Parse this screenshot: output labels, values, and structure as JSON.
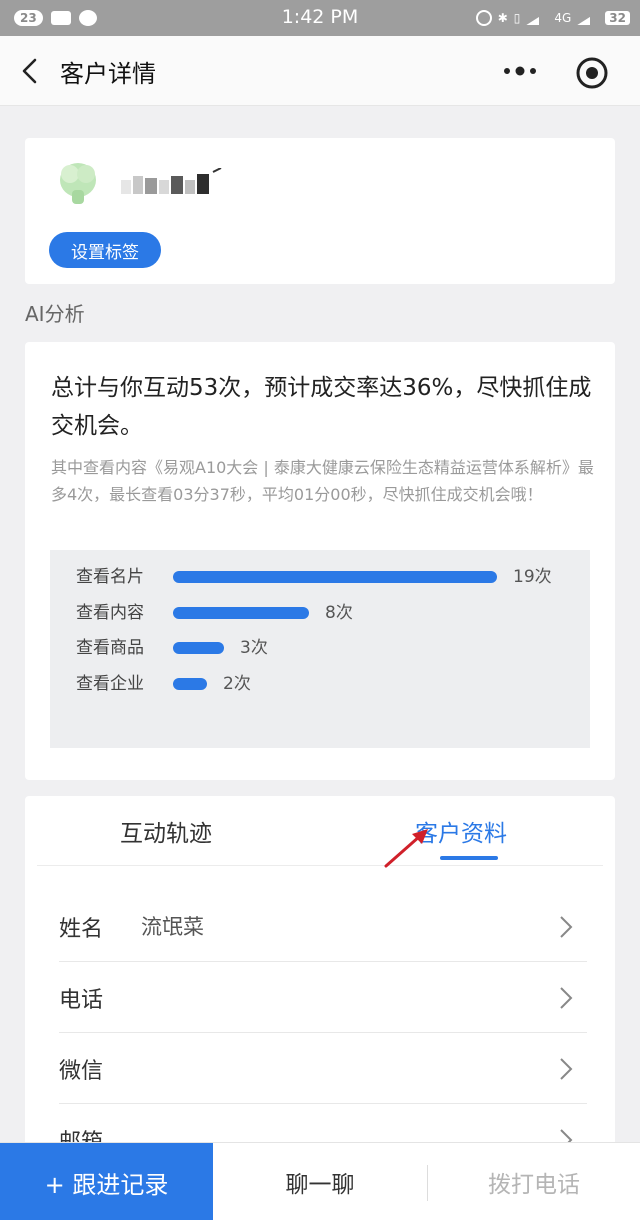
{
  "status_bar": {
    "notification_count": "23",
    "time": "1:42 PM",
    "battery": "32",
    "network": "4G"
  },
  "nav": {
    "title": "客户详情",
    "back_icon": "chevron-left-icon",
    "more_icon": "more-dots-icon",
    "target_icon": "target-icon"
  },
  "profile": {
    "tag_button": "设置标签"
  },
  "ai_section": {
    "label": "AI分析",
    "headline": "总计与你互动53次，预计成交率达36%，尽快抓住成交机会。",
    "description": "其中查看内容《易观A10大会 | 泰康大健康云保险生态精益运营体系解析》最多4次，最长查看03分37秒，平均01分00秒，尽快抓住成交机会哦！",
    "stats": [
      {
        "label": "查看名片",
        "count": "19次",
        "value": 19
      },
      {
        "label": "查看内容",
        "count": "8次",
        "value": 8
      },
      {
        "label": "查看商品",
        "count": "3次",
        "value": 3
      },
      {
        "label": "查看企业",
        "count": "2次",
        "value": 2
      }
    ]
  },
  "tabs": [
    {
      "label": "互动轨迹",
      "active": false
    },
    {
      "label": "客户资料",
      "active": true
    }
  ],
  "fields": [
    {
      "label": "姓名",
      "value": "流氓菜"
    },
    {
      "label": "电话",
      "value": ""
    },
    {
      "label": "微信",
      "value": ""
    },
    {
      "label": "邮箱",
      "value": ""
    }
  ],
  "bottom_bar": {
    "follow_label": "+ 跟进记录",
    "chat_label": "聊一聊",
    "call_label": "拨打电话"
  },
  "colors": {
    "accent": "#2b79e6",
    "annotation_arrow": "#d0202a"
  }
}
